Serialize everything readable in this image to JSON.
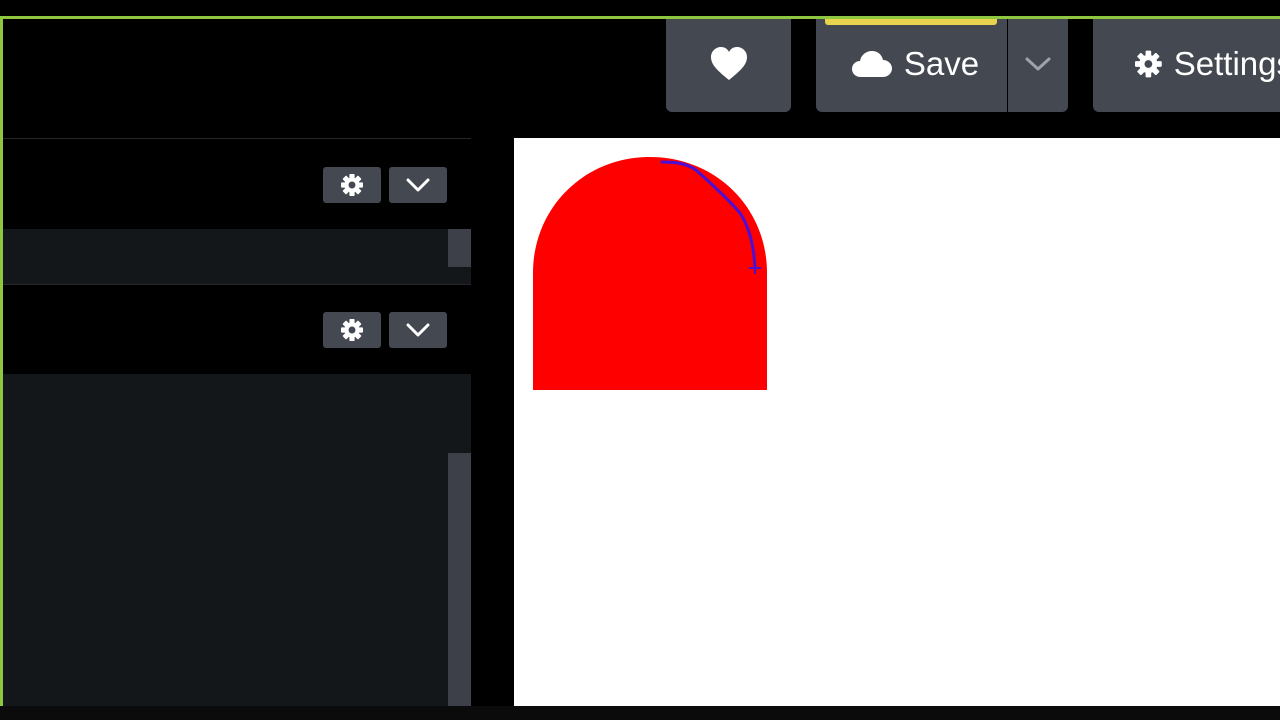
{
  "header": {
    "favorite_button": {
      "icon": "heart-icon"
    },
    "save_button": {
      "label": "Save",
      "icon": "cloud-icon",
      "accent_color": "#e8d44d"
    },
    "save_dropdown": {
      "icon": "chevron-down-icon"
    },
    "settings_button": {
      "label": "Settings",
      "icon": "gear-icon"
    }
  },
  "panels": [
    {
      "settings_icon": "gear-icon",
      "collapse_icon": "chevron-down-icon"
    },
    {
      "settings_icon": "gear-icon",
      "collapse_icon": "chevron-down-icon"
    }
  ],
  "canvas": {
    "shape": {
      "name": "red-arch",
      "fill": "#ff0000"
    },
    "path": {
      "stroke": "#4b0fd6"
    }
  },
  "colors": {
    "window_border": "#8ec63f",
    "button_bg": "#444851",
    "panel_body": "#141719"
  }
}
